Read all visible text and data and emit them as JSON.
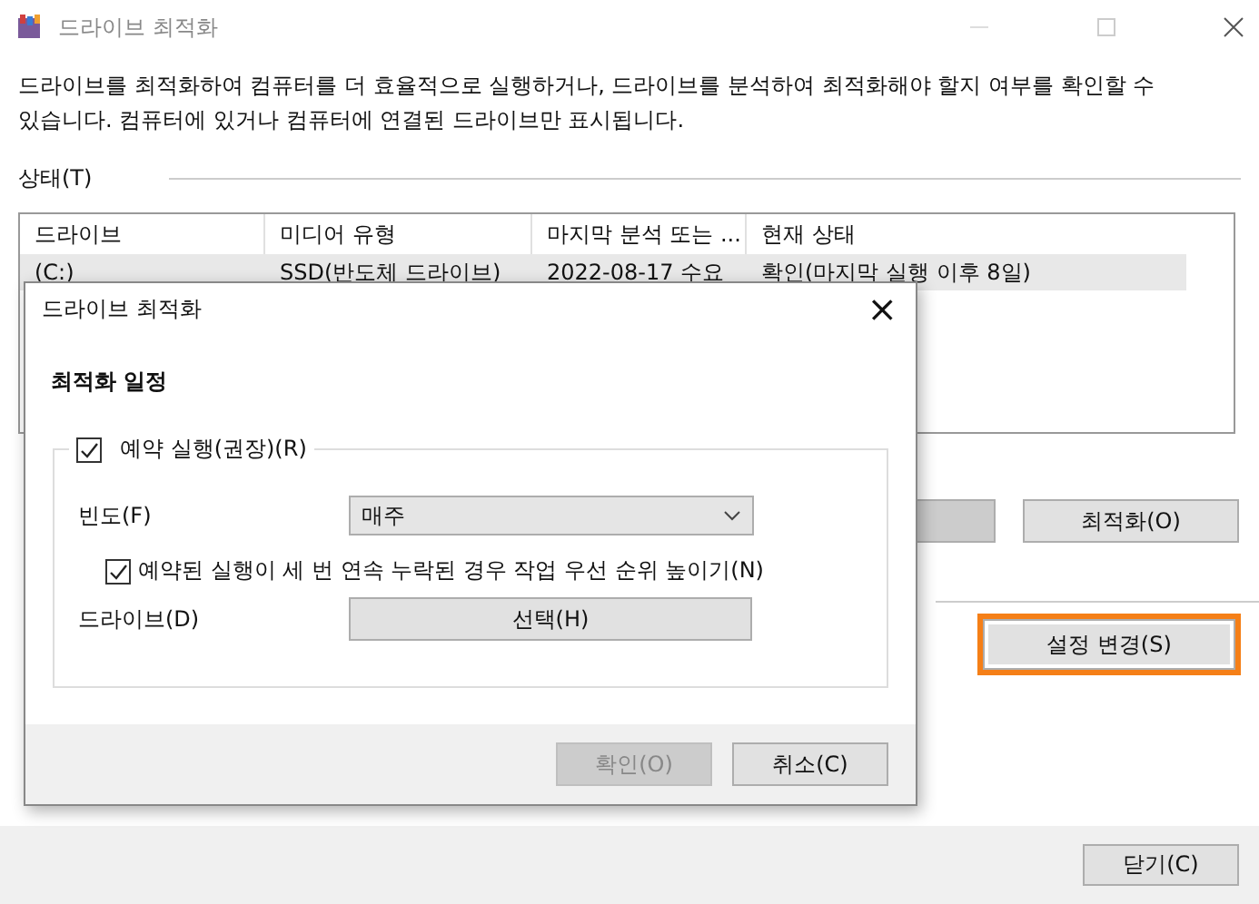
{
  "window": {
    "title": "드라이브 최적화"
  },
  "description": "드라이브를 최적화하여 컴퓨터를 더 효율적으로 실행하거나, 드라이브를 분석하여 최적화해야 할지 여부를 확인할 수 있습니다. 컴퓨터에 있거나 컴퓨터에 연결된 드라이브만 표시됩니다.",
  "status_label": "상태(T)",
  "table": {
    "columns": [
      "드라이브",
      "미디어 유형",
      "마지막 분석 또는 ...",
      "현재 상태"
    ],
    "rows": [
      {
        "cells": [
          "(C:)",
          "SSD(반도체 드라이브)",
          "2022-08-17 수요",
          "확인(마지막 실행 이후 8일)"
        ],
        "selected": true
      }
    ]
  },
  "optimize_button": "최적화(O)",
  "settings_button": {
    "label": "설정 변경(S)",
    "highlighted": true
  },
  "close_button": "닫기(C)",
  "dialog": {
    "title": "드라이브 최적화",
    "close": "×",
    "heading": "최적화 일정",
    "schedule": {
      "label": "예약 실행(권장)(R)",
      "checked": true
    },
    "frequency": {
      "label": "빈도(F)",
      "value": "매주"
    },
    "priority": {
      "label": "예약된 실행이 세 번 연속 누락된 경우 작업 우선 순위 높이기(N)",
      "checked": true
    },
    "drives": {
      "label": "드라이브(D)",
      "button": "선택(H)"
    },
    "ok": {
      "label": "확인(O)",
      "disabled": true
    },
    "cancel": {
      "label": "취소(C)",
      "disabled": false
    }
  }
}
